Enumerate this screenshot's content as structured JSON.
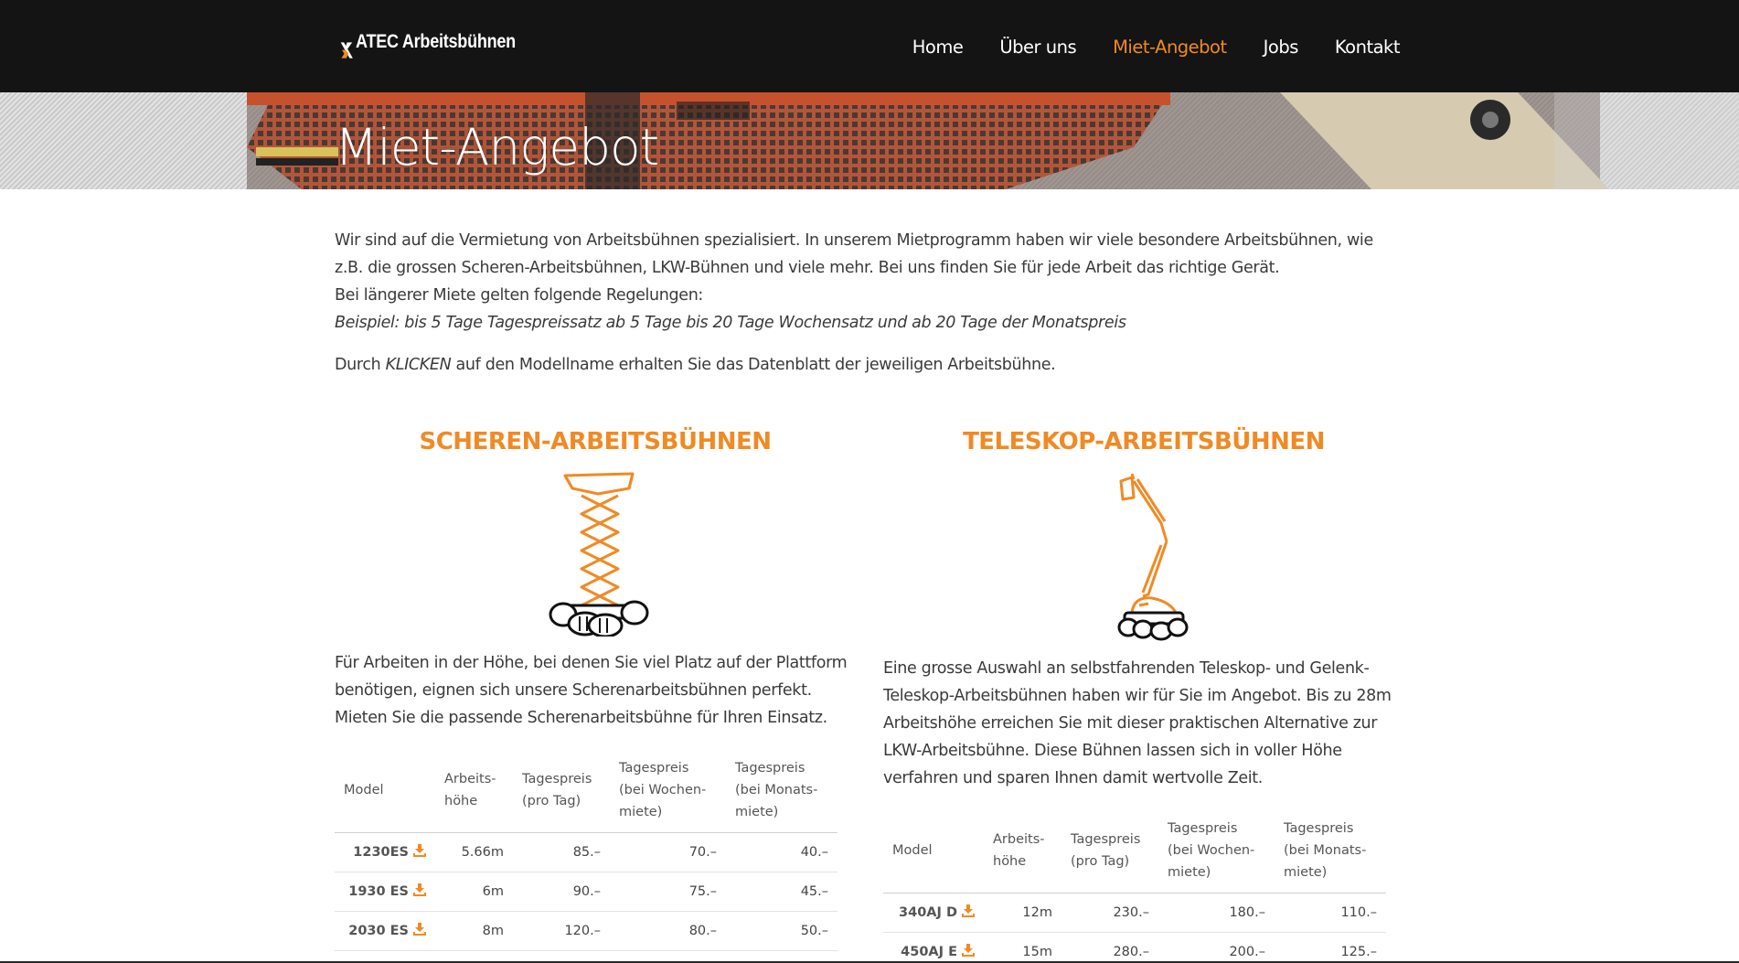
{
  "header": {
    "logo_text": "ATEC Arbeitsbühnen",
    "nav": [
      {
        "label": "Home",
        "active": false
      },
      {
        "label": "Über uns",
        "active": false
      },
      {
        "label": "Miet-Angebot",
        "active": true
      },
      {
        "label": "Jobs",
        "active": false
      },
      {
        "label": "Kontakt",
        "active": false
      }
    ]
  },
  "hero": {
    "title": "Miet-Angebot"
  },
  "intro": {
    "line1": "Wir sind auf die Vermietung von Arbeitsbühnen spezialisiert. In unserem Mietprogramm haben wir viele besondere Arbeitsbühnen, wie z.B. die grossen Scheren-Arbeitsbühnen, LKW-Bühnen und viele mehr. Bei uns finden Sie für jede Arbeit das richtige Gerät.",
    "line2": "Bei längerer Miete gelten folgende Regelungen:",
    "example": "Beispiel: bis 5 Tage Tagespreissatz ab 5 Tage bis 20 Tage Wochensatz und ab 20 Tage der Monatspreis",
    "click_pre": "Durch ",
    "click_em": "KLICKEN",
    "click_post": " auf den Modellname erhalten Sie das Datenblatt der jeweiligen Arbeitsbühne."
  },
  "table_headers": {
    "model": "Model",
    "height_1": "Arbeits-",
    "height_2": "höhe",
    "day_1": "Tagespreis",
    "day_2": "(pro Tag)",
    "week_1": "Tagespreis",
    "week_2": "(bei Wochen-",
    "week_3": "miete)",
    "month_1": "Tagespreis",
    "month_2": "(bei Monats-",
    "month_3": "miete)"
  },
  "scissor": {
    "title": "SCHEREN-ARBEITSBÜHNEN",
    "text": "Für Arbeiten in der Höhe, bei denen Sie viel Platz auf der Plattform benötigen, eignen sich unsere Scherenarbeitsbühnen perfekt. Mieten Sie die passende Scherenarbeitsbühne für Ihren Einsatz.",
    "rows": [
      {
        "model": "1230ES",
        "height": "5.66m",
        "day": "85.–",
        "week": "70.–",
        "month": "40.–"
      },
      {
        "model": "1930 ES",
        "height": "6m",
        "day": "90.–",
        "week": "75.–",
        "month": "45.–"
      },
      {
        "model": "2030 ES",
        "height": "8m",
        "day": "120.–",
        "week": "80.–",
        "month": "50.–"
      }
    ]
  },
  "telescope": {
    "title": "TELESKOP-ARBEITSBÜHNEN",
    "text": "Eine grosse Auswahl an selbstfahrenden Teleskop- und Gelenk-Teleskop-Arbeitsbühnen haben wir für Sie im Angebot. Bis zu 28m Arbeitshöhe erreichen Sie mit dieser praktischen Alternative zur LKW-Arbeitsbühne. Diese Bühnen lassen sich in voller Höhe verfahren und sparen Ihnen damit wertvolle Zeit.",
    "rows": [
      {
        "model": "340AJ D",
        "height": "12m",
        "day": "230.–",
        "week": "180.–",
        "month": "110.–"
      },
      {
        "model": "450AJ E",
        "height": "15m",
        "day": "280.–",
        "week": "200.–",
        "month": "125.–"
      }
    ]
  },
  "colors": {
    "accent": "#f08a24",
    "header_bg": "#141414"
  },
  "icons": {
    "download": "download-icon",
    "logo": "atec-logo-icon"
  }
}
